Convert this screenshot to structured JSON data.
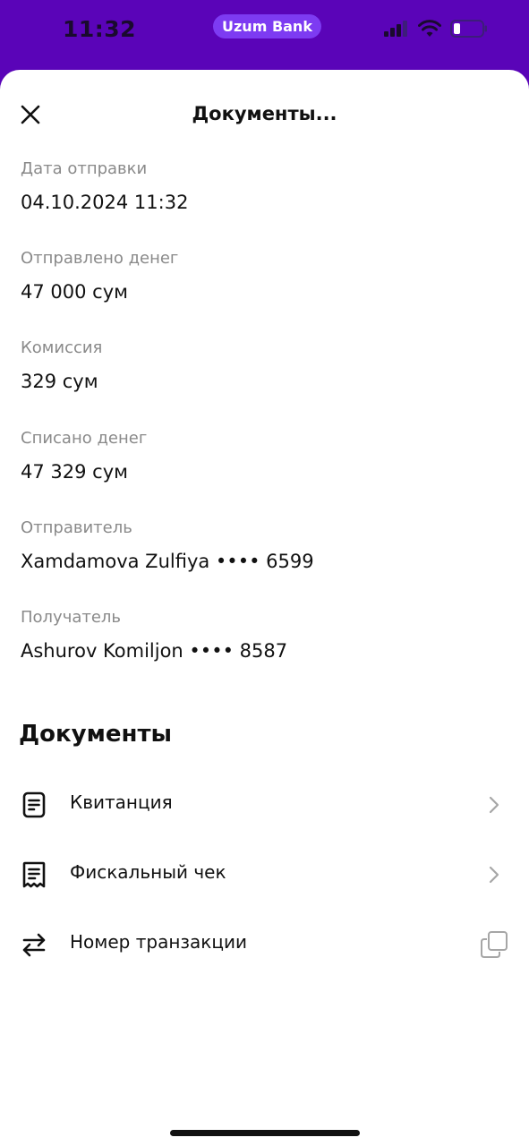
{
  "status_bar": {
    "time": "11:32",
    "app_pill": "Uzum Bank"
  },
  "header": {
    "title": "Документы..."
  },
  "details": [
    {
      "label": "Дата отправки",
      "value": "04.10.2024 11:32"
    },
    {
      "label": "Отправлено денег",
      "value": "47 000 сум"
    },
    {
      "label": "Комиссия",
      "value": "329 сум"
    },
    {
      "label": "Списано денег",
      "value": "47 329 сум"
    },
    {
      "label": "Отправитель",
      "value": "Xamdamova Zulfiya •••• 6599"
    },
    {
      "label": "Получатель",
      "value": "Ashurov Komiljon •••• 8587"
    }
  ],
  "documents": {
    "title": "Документы",
    "items": [
      {
        "label": "Квитанция",
        "icon": "receipt-document-icon",
        "action": "chevron-right-icon"
      },
      {
        "label": "Фискальный чек",
        "icon": "fiscal-receipt-icon",
        "action": "chevron-right-icon"
      },
      {
        "label": "Номер транзакции",
        "icon": "transfer-arrows-icon",
        "action": "copy-icon"
      }
    ]
  },
  "colors": {
    "brand": "#5a04b8",
    "pill": "#7d3bf2",
    "label_gray": "#8a8a8a",
    "text": "#111111"
  }
}
